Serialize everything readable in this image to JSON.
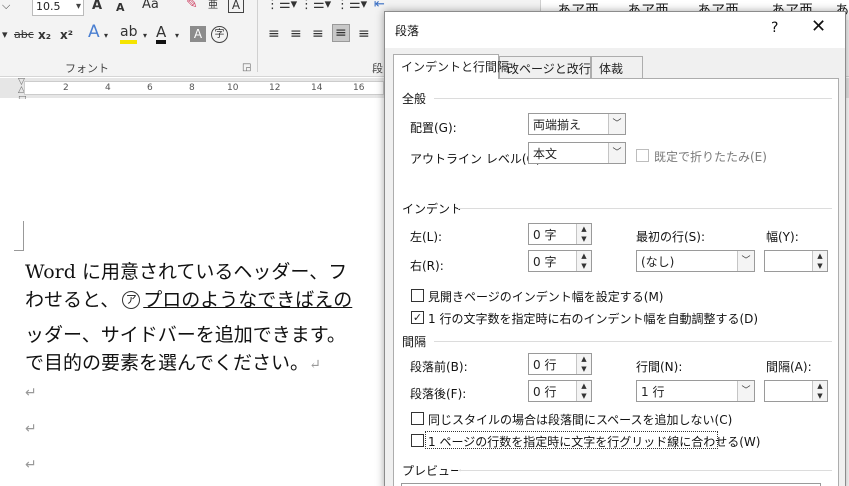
{
  "ribbon": {
    "font_size": "10.5",
    "font_size_arrow": "▾",
    "font_group_label": "フォント",
    "paragraph_group_label": "段",
    "strike_label": "abc",
    "subscript_label": "x₂",
    "superscript_label": "x²",
    "grow_font_label": "A",
    "shrink_font_label": "A",
    "change_case_label": "Aa",
    "style_samples": [
      "あア亜",
      "あア亜",
      "あア亜",
      "あア亜",
      "あ"
    ]
  },
  "ruler": {
    "ticks": [
      "2",
      "4",
      "6",
      "8",
      "10",
      "12",
      "14",
      "16"
    ]
  },
  "document": {
    "line1": "Word に用意されているヘッダー、フ",
    "line2_a": "わせると、",
    "line2_circled": "ア",
    "line2_b": "プロのようなできばえの",
    "line3": "ッダー、サイドバーを追加できます。",
    "line4": "で目的の要素を選んでください。",
    "para_mark": "↵"
  },
  "dialog": {
    "title": "段落",
    "help": "?",
    "close": "✕",
    "tabs": [
      "インデントと行間隔",
      "改ページと改行",
      "体裁"
    ],
    "general": {
      "section_label": "全般",
      "alignment_label": "配置(G):",
      "alignment_value": "両端揃え",
      "outline_label": "アウトライン レベル(O):",
      "outline_value": "本文",
      "collapse_label": "既定で折りたたみ(E)"
    },
    "indent": {
      "section_label": "インデント",
      "left_label": "左(L):",
      "left_value": "0 字",
      "right_label": "右(R):",
      "right_value": "0 字",
      "first_line_label": "最初の行(S):",
      "first_line_value": "(なし)",
      "width_label": "幅(Y):",
      "width_value": "",
      "mirror_label": "見開きページのインデント幅を設定する(M)",
      "mirror_checked": "",
      "auto_adjust_label": "1 行の文字数を指定時に右のインデント幅を自動調整する(D)",
      "auto_adjust_checked": "✓"
    },
    "spacing": {
      "section_label": "間隔",
      "before_label": "段落前(B):",
      "before_value": "0 行",
      "after_label": "段落後(F):",
      "after_value": "0 行",
      "line_spacing_label": "行間(N):",
      "line_spacing_value": "1 行",
      "at_label": "間隔(A):",
      "at_value": "",
      "no_space_label": "同じスタイルの場合は段落間にスペースを追加しない(C)",
      "grid_label": "1 ページの行数を指定時に文字を行グリッド線に合わせる(W)"
    },
    "preview": {
      "section_label": "プレビュー"
    }
  }
}
